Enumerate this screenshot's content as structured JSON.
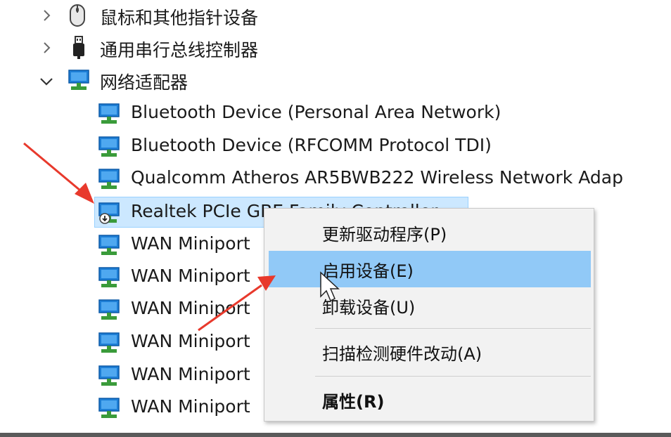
{
  "tree": {
    "categories": [
      {
        "label": "鼠标和其他指针设备",
        "expanded": false,
        "icon": "mouse-icon"
      },
      {
        "label": "通用串行总线控制器",
        "expanded": false,
        "icon": "usb-icon"
      },
      {
        "label": "网络适配器",
        "expanded": true,
        "icon": "network-adapter-icon"
      }
    ],
    "adapters": [
      {
        "label": "Bluetooth Device (Personal Area Network)",
        "icon": "network-adapter-icon"
      },
      {
        "label": "Bluetooth Device (RFCOMM Protocol TDI)",
        "icon": "network-adapter-icon"
      },
      {
        "label": "Qualcomm Atheros AR5BWB222 Wireless Network Adap",
        "icon": "network-adapter-icon"
      },
      {
        "label": "Realtek PCIe GBE Family Controller",
        "icon": "network-adapter-disabled-icon",
        "selected": true
      },
      {
        "label": "WAN Miniport",
        "icon": "network-adapter-icon"
      },
      {
        "label": "WAN Miniport",
        "icon": "network-adapter-icon"
      },
      {
        "label": "WAN Miniport",
        "icon": "network-adapter-icon"
      },
      {
        "label": "WAN Miniport",
        "icon": "network-adapter-icon"
      },
      {
        "label": "WAN Miniport",
        "icon": "network-adapter-icon"
      },
      {
        "label": "WAN Miniport",
        "icon": "network-adapter-icon"
      }
    ]
  },
  "context_menu": {
    "items": [
      {
        "label": "更新驱动程序(P)",
        "hover": false,
        "bold": false
      },
      {
        "label": "启用设备(E)",
        "hover": true,
        "bold": false
      },
      {
        "label": "卸载设备(U)",
        "hover": false,
        "bold": false
      },
      {
        "label": "扫描检测硬件改动(A)",
        "hover": false,
        "bold": false
      },
      {
        "label": "属性(R)",
        "hover": false,
        "bold": true
      }
    ]
  },
  "colors": {
    "selection": "#cce8ff",
    "menu_hover": "#91c9f7",
    "annotation_arrow": "#e8392c",
    "adapter_icon": "#1e7fd6",
    "adapter_icon_base": "#3a9b3a"
  }
}
